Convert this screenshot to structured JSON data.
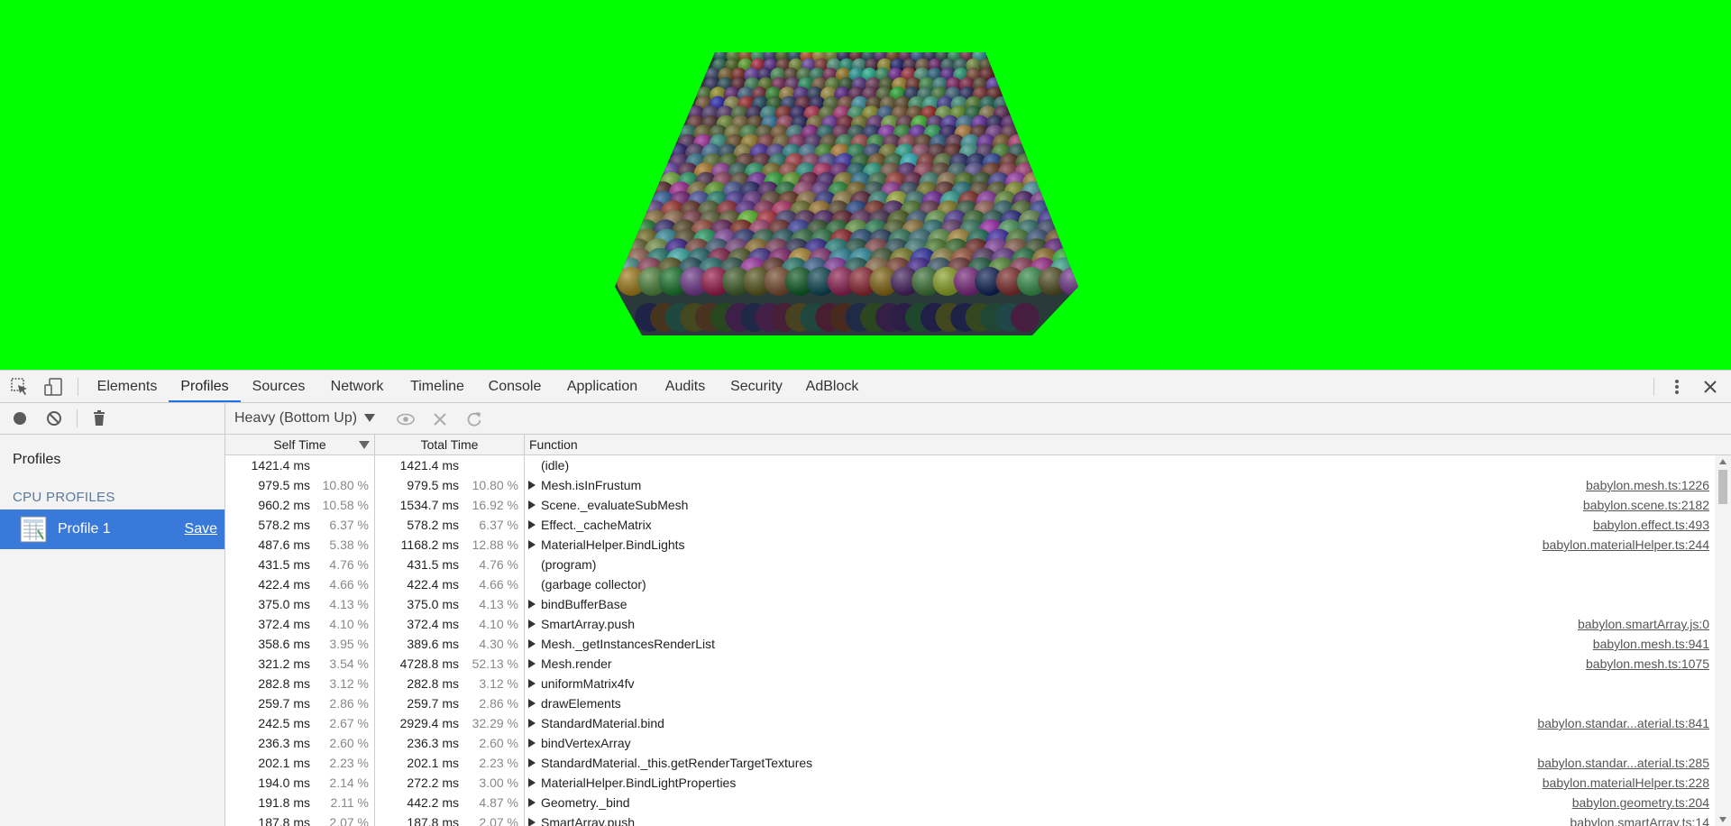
{
  "tabs": [
    {
      "label": "Elements"
    },
    {
      "label": "Profiles"
    },
    {
      "label": "Sources"
    },
    {
      "label": "Network"
    },
    {
      "label": "Timeline"
    },
    {
      "label": "Console"
    },
    {
      "label": "Application"
    },
    {
      "label": "Audits"
    },
    {
      "label": "Security"
    },
    {
      "label": "AdBlock"
    }
  ],
  "icons": {
    "inspect": "inspect-element-icon",
    "device": "device-mode-icon",
    "menu": "more-vertical-icon",
    "close": "close-icon",
    "record": "record-icon",
    "clear": "clear-all-icon",
    "trash": "trash-icon",
    "focus": "eye-icon",
    "exclude": "x-icon",
    "restore": "refresh-icon"
  },
  "sidebar": {
    "title": "Profiles",
    "section": "CPU PROFILES",
    "profile_label": "Profile 1",
    "save_label": "Save"
  },
  "toolbar": {
    "view_mode": "Heavy (Bottom Up)"
  },
  "columns": {
    "self": "Self Time",
    "total": "Total Time",
    "function": "Function"
  },
  "rows": [
    {
      "self_time": "1421.4 ms",
      "self_pct": "",
      "total_time": "1421.4 ms",
      "total_pct": "",
      "function": "(idle)",
      "url": "",
      "expandable": false
    },
    {
      "self_time": "979.5 ms",
      "self_pct": "10.80 %",
      "total_time": "979.5 ms",
      "total_pct": "10.80 %",
      "function": "Mesh.isInFrustum",
      "url": "babylon.mesh.ts:1226",
      "expandable": true
    },
    {
      "self_time": "960.2 ms",
      "self_pct": "10.58 %",
      "total_time": "1534.7 ms",
      "total_pct": "16.92 %",
      "function": "Scene._evaluateSubMesh",
      "url": "babylon.scene.ts:2182",
      "expandable": true
    },
    {
      "self_time": "578.2 ms",
      "self_pct": "6.37 %",
      "total_time": "578.2 ms",
      "total_pct": "6.37 %",
      "function": "Effect._cacheMatrix",
      "url": "babylon.effect.ts:493",
      "expandable": true
    },
    {
      "self_time": "487.6 ms",
      "self_pct": "5.38 %",
      "total_time": "1168.2 ms",
      "total_pct": "12.88 %",
      "function": "MaterialHelper.BindLights",
      "url": "babylon.materialHelper.ts:244",
      "expandable": true
    },
    {
      "self_time": "431.5 ms",
      "self_pct": "4.76 %",
      "total_time": "431.5 ms",
      "total_pct": "4.76 %",
      "function": "(program)",
      "url": "",
      "expandable": false
    },
    {
      "self_time": "422.4 ms",
      "self_pct": "4.66 %",
      "total_time": "422.4 ms",
      "total_pct": "4.66 %",
      "function": "(garbage collector)",
      "url": "",
      "expandable": false
    },
    {
      "self_time": "375.0 ms",
      "self_pct": "4.13 %",
      "total_time": "375.0 ms",
      "total_pct": "4.13 %",
      "function": "bindBufferBase",
      "url": "",
      "expandable": true
    },
    {
      "self_time": "372.4 ms",
      "self_pct": "4.10 %",
      "total_time": "372.4 ms",
      "total_pct": "4.10 %",
      "function": "SmartArray.push",
      "url": "babylon.smartArray.js:0",
      "expandable": true
    },
    {
      "self_time": "358.6 ms",
      "self_pct": "3.95 %",
      "total_time": "389.6 ms",
      "total_pct": "4.30 %",
      "function": "Mesh._getInstancesRenderList",
      "url": "babylon.mesh.ts:941",
      "expandable": true
    },
    {
      "self_time": "321.2 ms",
      "self_pct": "3.54 %",
      "total_time": "4728.8 ms",
      "total_pct": "52.13 %",
      "function": "Mesh.render",
      "url": "babylon.mesh.ts:1075",
      "expandable": true
    },
    {
      "self_time": "282.8 ms",
      "self_pct": "3.12 %",
      "total_time": "282.8 ms",
      "total_pct": "3.12 %",
      "function": "uniformMatrix4fv",
      "url": "",
      "expandable": true
    },
    {
      "self_time": "259.7 ms",
      "self_pct": "2.86 %",
      "total_time": "259.7 ms",
      "total_pct": "2.86 %",
      "function": "drawElements",
      "url": "",
      "expandable": true
    },
    {
      "self_time": "242.5 ms",
      "self_pct": "2.67 %",
      "total_time": "2929.4 ms",
      "total_pct": "32.29 %",
      "function": "StandardMaterial.bind",
      "url": "babylon.standar...aterial.ts:841",
      "expandable": true
    },
    {
      "self_time": "236.3 ms",
      "self_pct": "2.60 %",
      "total_time": "236.3 ms",
      "total_pct": "2.60 %",
      "function": "bindVertexArray",
      "url": "",
      "expandable": true
    },
    {
      "self_time": "202.1 ms",
      "self_pct": "2.23 %",
      "total_time": "202.1 ms",
      "total_pct": "2.23 %",
      "function": "StandardMaterial._this.getRenderTargetTextures",
      "url": "babylon.standar...aterial.ts:285",
      "expandable": true
    },
    {
      "self_time": "194.0 ms",
      "self_pct": "2.14 %",
      "total_time": "272.2 ms",
      "total_pct": "3.00 %",
      "function": "MaterialHelper.BindLightProperties",
      "url": "babylon.materialHelper.ts:228",
      "expandable": true
    },
    {
      "self_time": "191.8 ms",
      "self_pct": "2.11 %",
      "total_time": "442.2 ms",
      "total_pct": "4.87 %",
      "function": "Geometry._bind",
      "url": "babylon.geometry.ts:204",
      "expandable": true
    },
    {
      "self_time": "187.8 ms",
      "self_pct": "2.07 %",
      "total_time": "187.8 ms",
      "total_pct": "2.07 %",
      "function": "SmartArray.push",
      "url": "babylon.smartArray.ts:14",
      "expandable": true
    }
  ]
}
